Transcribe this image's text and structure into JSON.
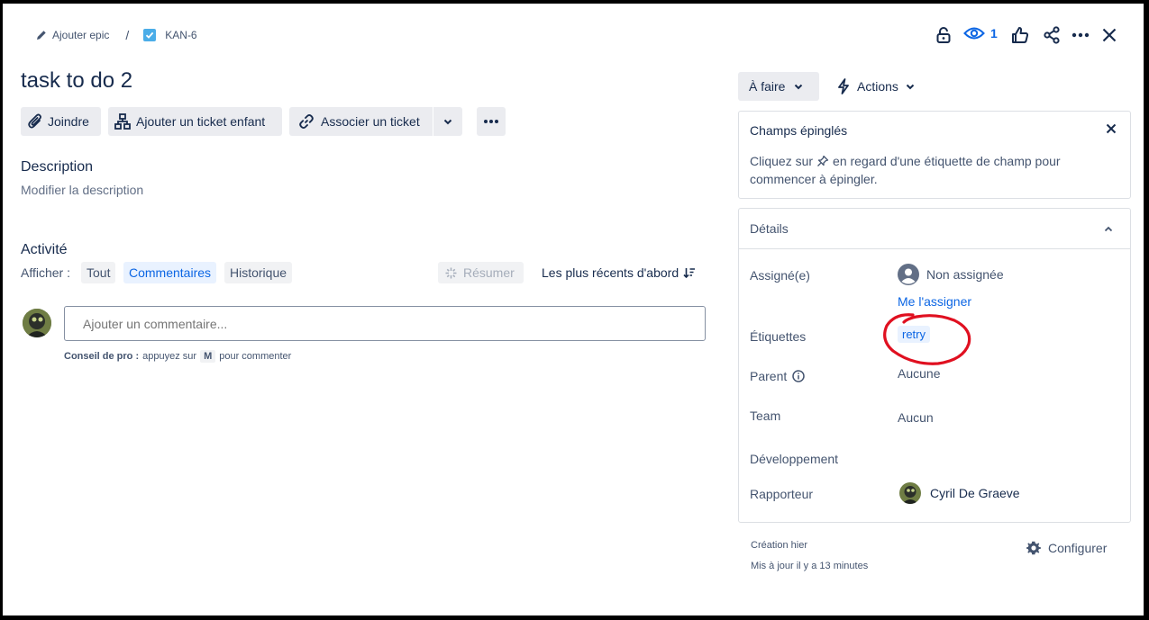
{
  "breadcrumb": {
    "epic_label": "Ajouter epic",
    "separator": "/",
    "issue_key": "KAN-6"
  },
  "header_actions": {
    "watch_count": "1"
  },
  "issue": {
    "title": "task to do 2"
  },
  "toolbar": {
    "attach_label": "Joindre",
    "add_child_label": "Ajouter un ticket enfant",
    "link_issue_label": "Associer un ticket"
  },
  "description": {
    "heading": "Description",
    "placeholder": "Modifier la description"
  },
  "activity": {
    "heading": "Activité",
    "show_label": "Afficher :",
    "filters": [
      "Tout",
      "Commentaires",
      "Historique"
    ],
    "active_filter": "Commentaires",
    "summarize_label": "Résumer",
    "sort_label": "Les plus récents d'abord",
    "comment_placeholder": "Ajouter un commentaire...",
    "pro_tip_label": "Conseil de pro :",
    "pro_tip_before": "appuyez sur",
    "pro_tip_key": "M",
    "pro_tip_after": "pour commenter"
  },
  "status": {
    "label": "À faire",
    "actions_label": "Actions"
  },
  "pinned": {
    "title": "Champs épinglés",
    "text_before": "Cliquez sur",
    "text_after": "en regard d'une étiquette de champ pour",
    "text_line2": "commencer à épingler."
  },
  "details": {
    "title": "Détails",
    "assignee_label": "Assigné(e)",
    "assignee_value": "Non assignée",
    "assign_me_label": "Me l'assigner",
    "labels_label": "Étiquettes",
    "label_tag": "retry",
    "parent_label": "Parent",
    "parent_value": "Aucune",
    "team_label": "Team",
    "team_value": "Aucun",
    "development_label": "Développement",
    "reporter_label": "Rapporteur",
    "reporter_value": "Cyril De Graeve"
  },
  "footer": {
    "created": "Création hier",
    "updated": "Mis à jour il y a 13 minutes",
    "configure_label": "Configurer"
  },
  "colors": {
    "accent_blue": "#0c66e4",
    "annotation_red": "#e01020",
    "tag_bg": "#e9f2ff"
  }
}
